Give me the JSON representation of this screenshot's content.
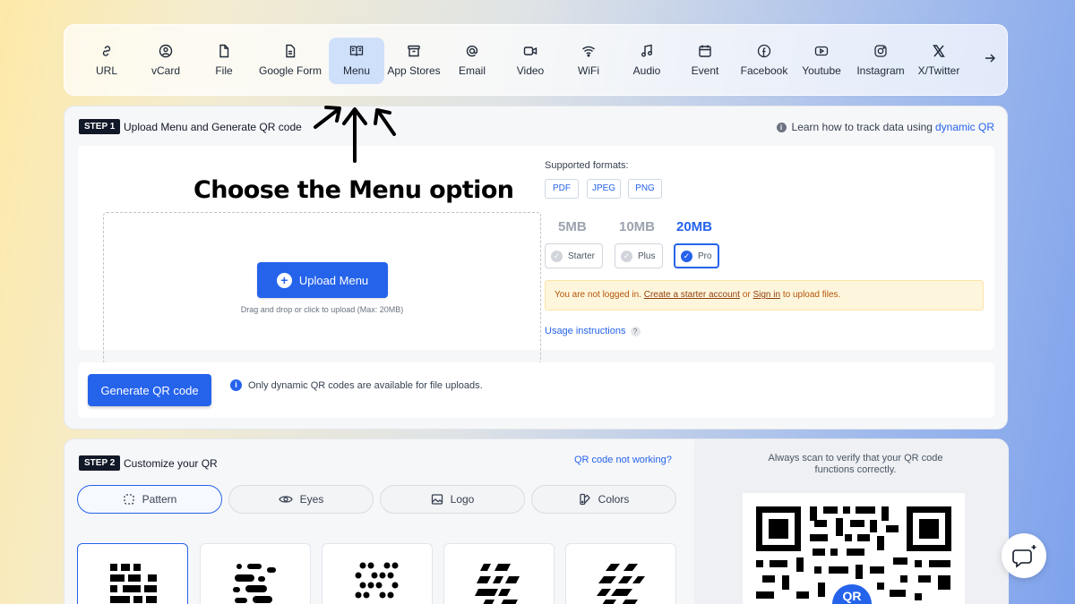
{
  "nav": {
    "items": [
      {
        "label": "URL",
        "icon": "link-icon"
      },
      {
        "label": "vCard",
        "icon": "user-circle-icon"
      },
      {
        "label": "File",
        "icon": "file-icon"
      },
      {
        "label": "Google Form",
        "icon": "form-icon"
      },
      {
        "label": "Menu",
        "icon": "book-open-icon",
        "active": true
      },
      {
        "label": "App Stores",
        "icon": "store-icon"
      },
      {
        "label": "Email",
        "icon": "at-icon"
      },
      {
        "label": "Video",
        "icon": "video-icon"
      },
      {
        "label": "WiFi",
        "icon": "wifi-icon"
      },
      {
        "label": "Audio",
        "icon": "music-icon"
      },
      {
        "label": "Event",
        "icon": "calendar-icon"
      },
      {
        "label": "Facebook",
        "icon": "facebook-icon"
      },
      {
        "label": "Youtube",
        "icon": "youtube-icon"
      },
      {
        "label": "Instagram",
        "icon": "instagram-icon"
      },
      {
        "label": "X/Twitter",
        "icon": "x-icon"
      }
    ],
    "more_icon": "arrow-right-icon"
  },
  "step1": {
    "badge": "STEP 1",
    "title": "Upload Menu and Generate QR code",
    "learn_text": "Learn how to track data using",
    "learn_link": "dynamic QR",
    "upload_label": "Upload Menu",
    "drag_hint": "Drag and drop or click to upload (Max: 20MB)",
    "formats_label": "Supported formats:",
    "formats": [
      "PDF",
      "JPEG",
      "PNG"
    ],
    "sizes": [
      "5MB",
      "10MB",
      "20MB"
    ],
    "plans": [
      "Starter",
      "Plus",
      "Pro"
    ],
    "selected_plan": "Pro",
    "warning_prefix": "You are not logged in.",
    "warning_link1": "Create a starter account",
    "warning_mid": "or",
    "warning_link2": "Sign in",
    "warning_suffix": "to upload files.",
    "usage_link": "Usage instructions",
    "generate_label": "Generate QR code",
    "dynamic_note": "Only dynamic QR codes are available for file uploads."
  },
  "step2": {
    "badge": "STEP 2",
    "title": "Customize your QR",
    "not_working": "QR code not working?",
    "tabs": [
      {
        "label": "Pattern",
        "icon": "pattern-icon"
      },
      {
        "label": "Eyes",
        "icon": "eye-icon"
      },
      {
        "label": "Logo",
        "icon": "image-icon"
      },
      {
        "label": "Colors",
        "icon": "palette-icon"
      }
    ],
    "scan_note": "Always scan to verify that your QR code functions correctly.",
    "qr_badge": "QR"
  },
  "annotation": {
    "text": "Choose the Menu option"
  },
  "colors": {
    "accent": "#2563eb",
    "active_nav": "#cfe0fb",
    "warning_bg": "#fef6dc"
  }
}
